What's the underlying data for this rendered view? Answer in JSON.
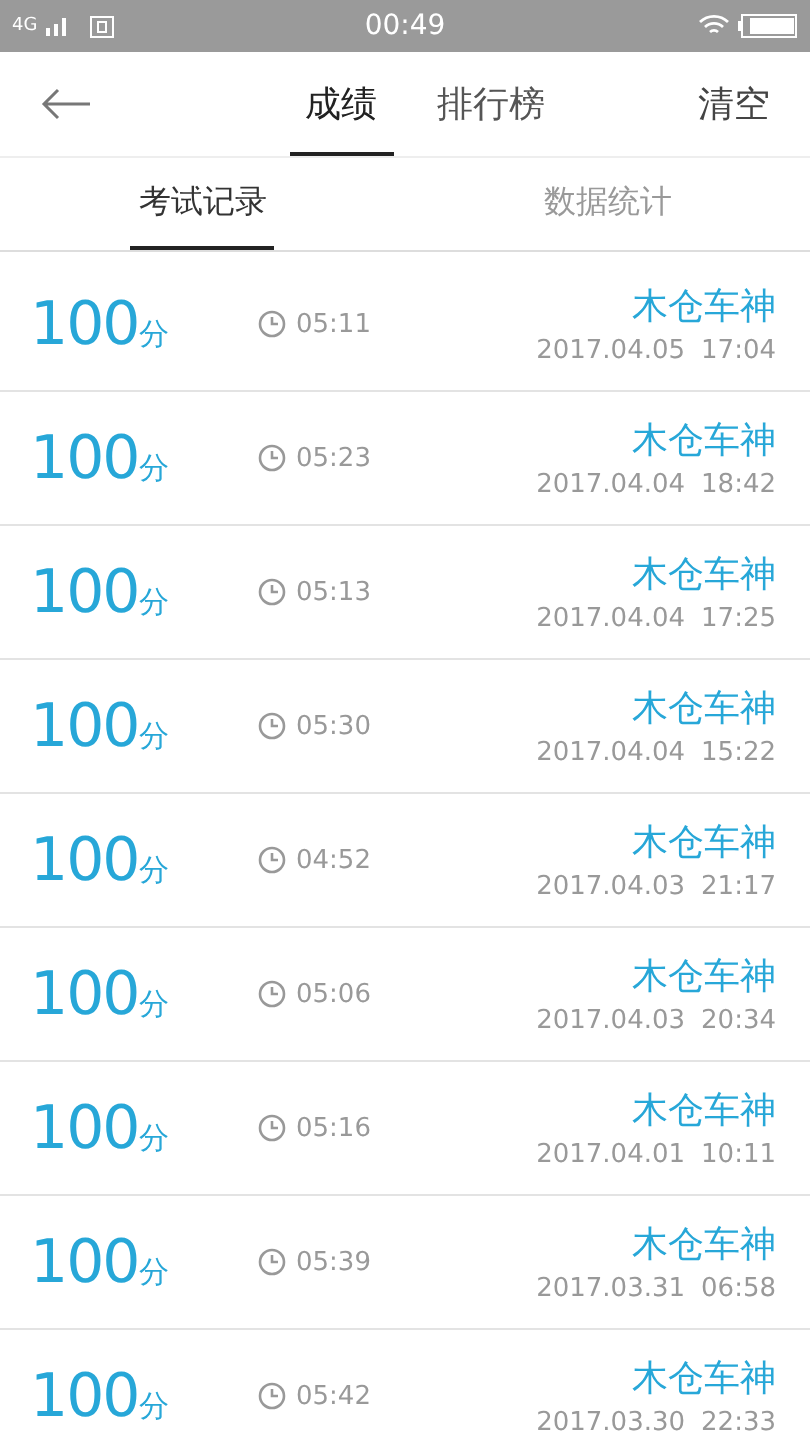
{
  "status_bar": {
    "network": "4G",
    "time": "00:49"
  },
  "header": {
    "tabs": [
      {
        "label": "成绩",
        "selected": true
      },
      {
        "label": "排行榜",
        "selected": false
      }
    ],
    "action": "清空"
  },
  "sub_tabs": [
    {
      "label": "考试记录",
      "selected": true
    },
    {
      "label": "数据统计",
      "selected": false
    }
  ],
  "records": [
    {
      "score": "100",
      "unit": "分",
      "duration": "05:11",
      "name": "木仓车神",
      "date": "2017.04.05",
      "time": "17:04"
    },
    {
      "score": "100",
      "unit": "分",
      "duration": "05:23",
      "name": "木仓车神",
      "date": "2017.04.04",
      "time": "18:42"
    },
    {
      "score": "100",
      "unit": "分",
      "duration": "05:13",
      "name": "木仓车神",
      "date": "2017.04.04",
      "time": "17:25"
    },
    {
      "score": "100",
      "unit": "分",
      "duration": "05:30",
      "name": "木仓车神",
      "date": "2017.04.04",
      "time": "15:22"
    },
    {
      "score": "100",
      "unit": "分",
      "duration": "04:52",
      "name": "木仓车神",
      "date": "2017.04.03",
      "time": "21:17"
    },
    {
      "score": "100",
      "unit": "分",
      "duration": "05:06",
      "name": "木仓车神",
      "date": "2017.04.03",
      "time": "20:34"
    },
    {
      "score": "100",
      "unit": "分",
      "duration": "05:16",
      "name": "木仓车神",
      "date": "2017.04.01",
      "time": "10:11"
    },
    {
      "score": "100",
      "unit": "分",
      "duration": "05:39",
      "name": "木仓车神",
      "date": "2017.03.31",
      "time": "06:58"
    },
    {
      "score": "100",
      "unit": "分",
      "duration": "05:42",
      "name": "木仓车神",
      "date": "2017.03.30",
      "time": "22:33"
    }
  ]
}
